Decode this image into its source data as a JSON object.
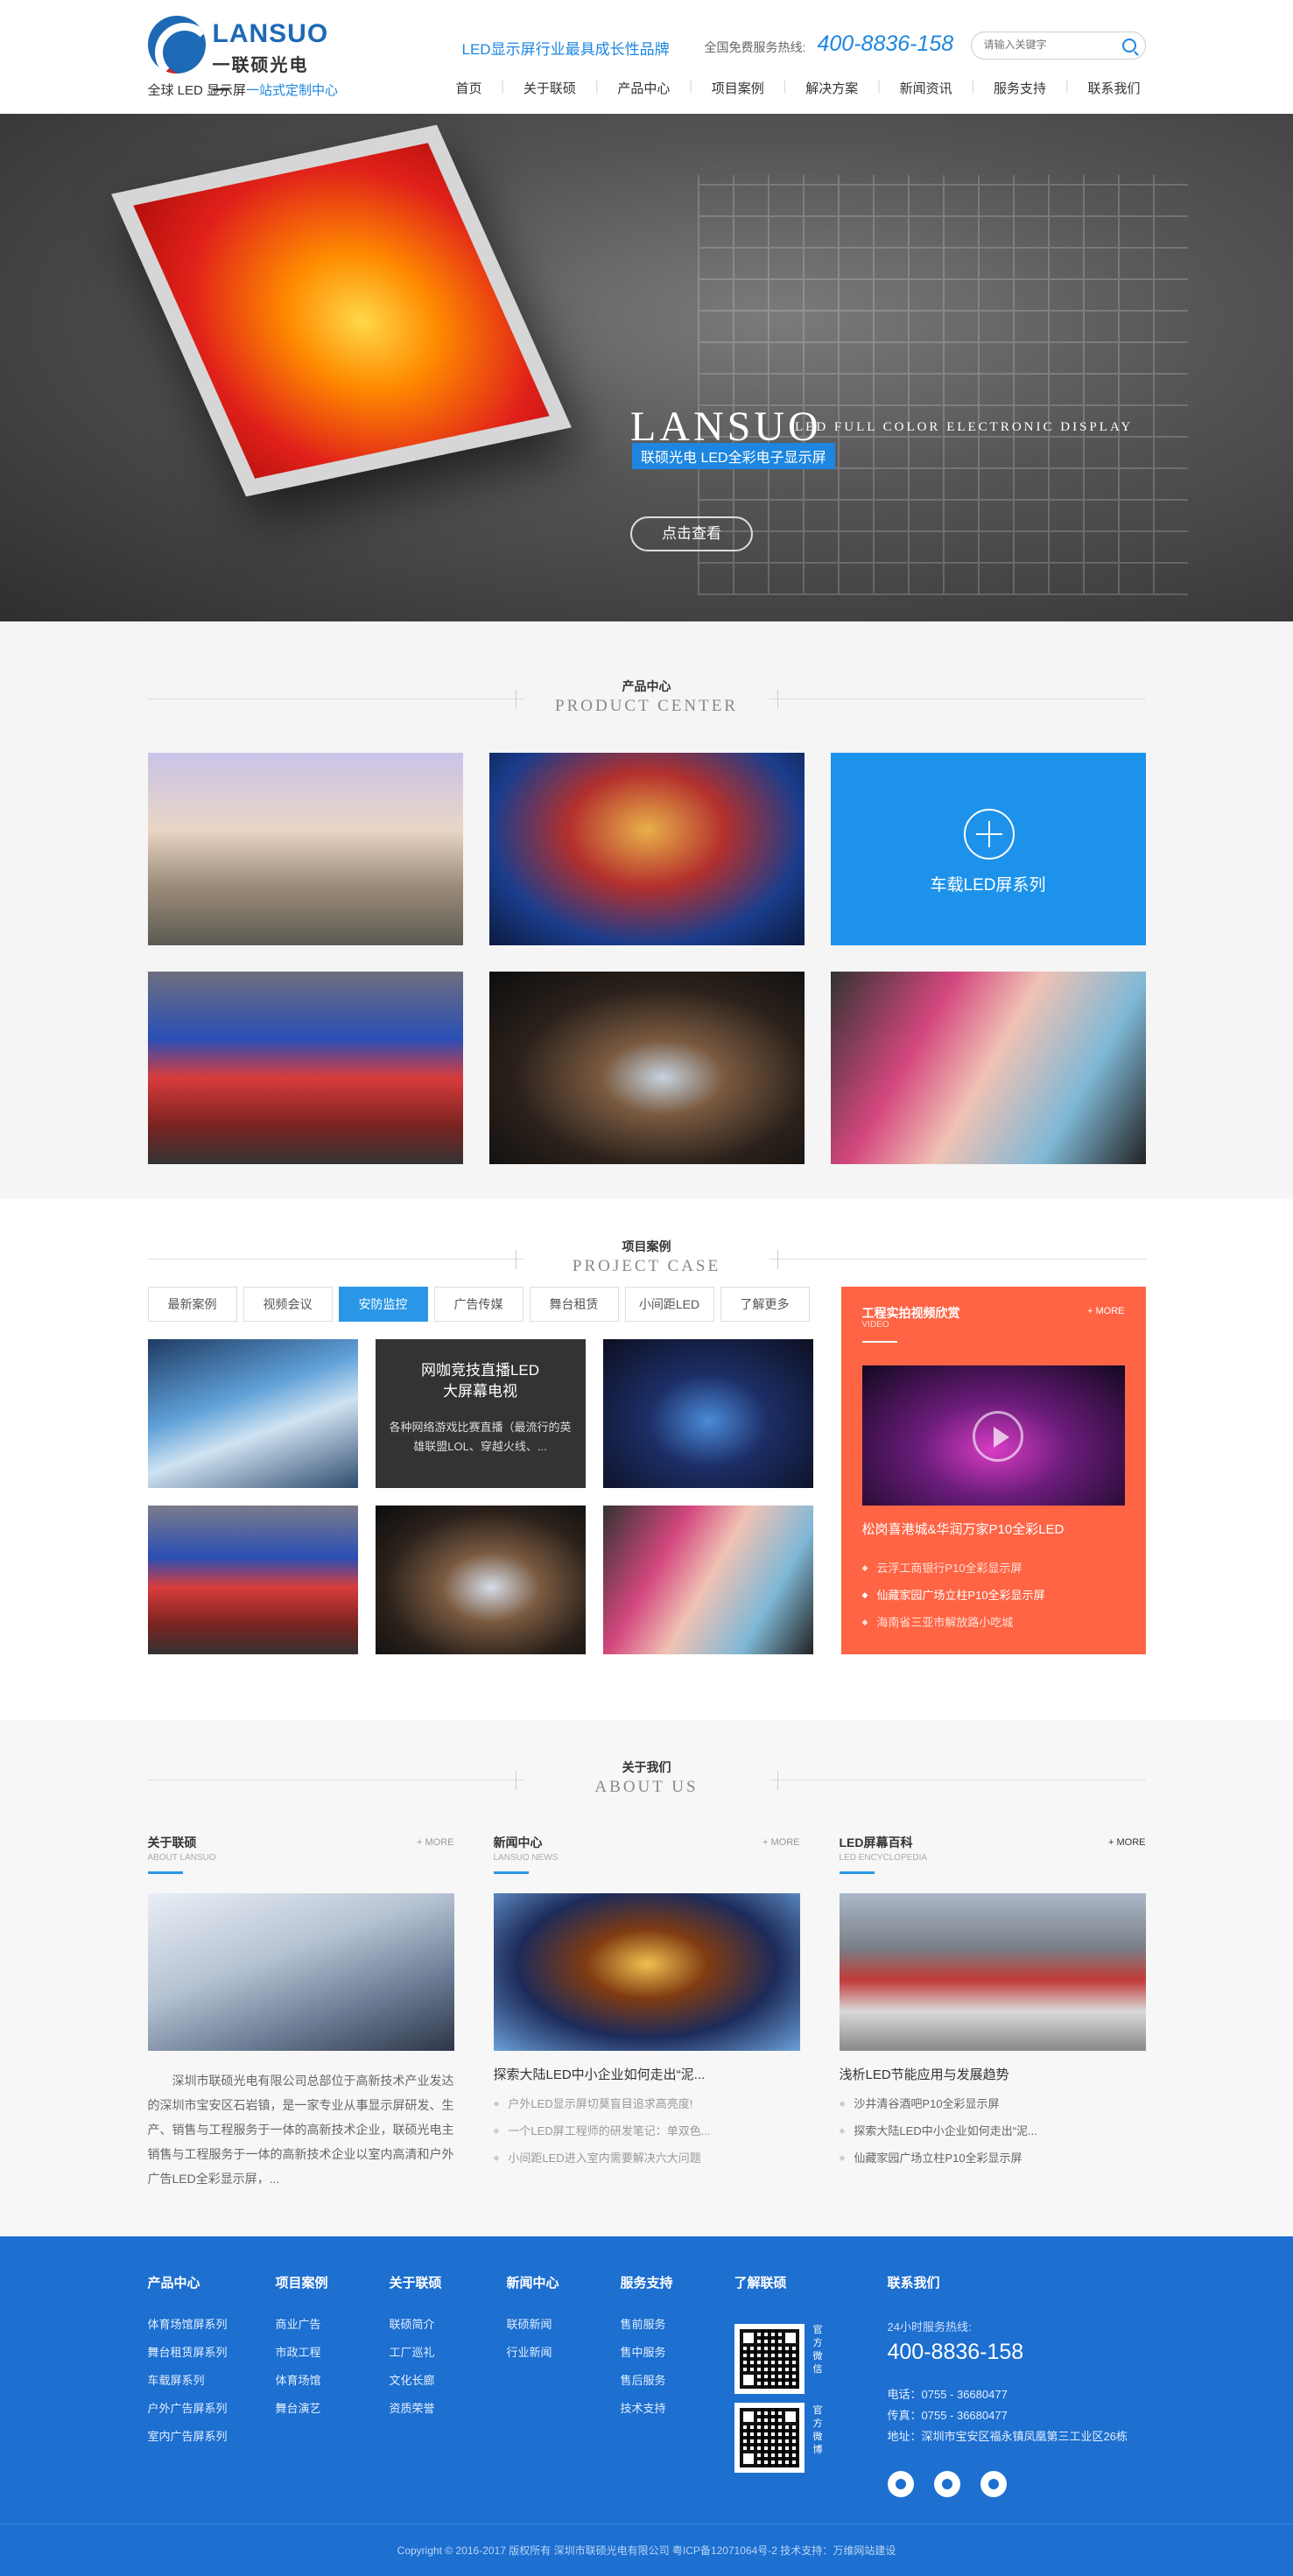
{
  "header": {
    "logo_word": "LANSUO",
    "logo_cn": "一联硕光电一",
    "logo_sub_a": "全球 LED 显示屏",
    "logo_sub_b": "一站式定制中心",
    "slogan": "LED显示屏行业最具成长性品牌",
    "hotline_label": "全国免费服务热线:",
    "hotline": "400-8836-158",
    "search_placeholder": "请输入关键字"
  },
  "nav": [
    "首页",
    "关于联硕",
    "产品中心",
    "项目案例",
    "解决方案",
    "新闻资讯",
    "服务支持",
    "联系我们"
  ],
  "banner": {
    "brand": "LANSUO",
    "en": "LED FULL COLOR ELECTRONIC DISPLAY",
    "cn": "联硕光电 LED全彩电子显示屏",
    "button": "点击查看"
  },
  "products": {
    "title_cn": "产品中心",
    "title_en": "PRODUCT CENTER",
    "feature_label": "车载LED屏系列"
  },
  "cases": {
    "title_cn": "项目案例",
    "title_en": "PROJECT CASE",
    "tabs": [
      "最新案例",
      "视频会议",
      "安防监控",
      "广告传媒",
      "舞台租赁",
      "小间距LED",
      "了解更多"
    ],
    "overlay_title": "网咖竞技直播LED\n大屏幕电视",
    "overlay_desc": "各种网络游戏比赛直播（最流行的英雄联盟LOL、穿越火线、..."
  },
  "video": {
    "title": "工程实拍视频欣赏",
    "en": "VIDEO",
    "more": "+ MORE",
    "caption": "松岗喜港城&华润万家P10全彩LED",
    "items": [
      "云浮工商银行P10全彩显示屏",
      "仙藏家园广场立柱P10全彩显示屏",
      "海南省三亚市解放路小吃城"
    ]
  },
  "about": {
    "title_cn": "关于我们",
    "title_en": "ABOUT US",
    "col1": {
      "h": "关于联硕",
      "en": "ABOUT LANSUO",
      "more": "+ MORE",
      "text": "深圳市联硕光电有限公司总部位于高新技术产业发达的深圳市宝安区石岩镇，是一家专业从事显示屏研发、生产、销售与工程服务于一体的高新技术企业，联硕光电主销售与工程服务于一体的高新技术企业以室内高清和户外广告LED全彩显示屏，..."
    },
    "col2": {
      "h": "新闻中心",
      "en": "LANSUO NEWS",
      "more": "+ MORE",
      "title": "探索大陆LED中小企业如何走出“泥...",
      "items": [
        "户外LED显示屏切莫盲目追求高亮度!",
        "一个LED屏工程师的研发笔记：单双色...",
        "小间距LED进入室内需要解决六大问题"
      ]
    },
    "col3": {
      "h": "LED屏幕百科",
      "en": "LED ENCYCLOPEDIA",
      "more": "+ MORE",
      "title": "浅析LED节能应用与发展趋势",
      "items": [
        "沙井清谷酒吧P10全彩显示屏",
        "探索大陆LED中小企业如何走出“泥...",
        "仙藏家园广场立柱P10全彩显示屏"
      ]
    }
  },
  "footer": {
    "cols": [
      {
        "h": "产品中心",
        "items": [
          "体育场馆屏系列",
          "舞台租赁屏系列",
          "车载屏系列",
          "户外广告屏系列",
          "室内广告屏系列"
        ]
      },
      {
        "h": "项目案例",
        "items": [
          "商业广告",
          "市政工程",
          "体育场馆",
          "舞台演艺"
        ]
      },
      {
        "h": "关于联硕",
        "items": [
          "联硕简介",
          "工厂巡礼",
          "文化长廊",
          "资质荣誉"
        ]
      },
      {
        "h": "新闻中心",
        "items": [
          "联硕新闻",
          "行业新闻"
        ]
      },
      {
        "h": "服务支持",
        "items": [
          "售前服务",
          "售中服务",
          "售后服务",
          "技术支持"
        ]
      },
      {
        "h": "了解联硕",
        "items": []
      }
    ],
    "qr1": "官方微信",
    "qr2": "官方微博",
    "contact_h": "联系我们",
    "hours": "24小时服务热线:",
    "tel": "400-8836-158",
    "phone": "电话：0755 - 36680477",
    "fax": "传真：0755 - 36680477",
    "addr": "地址：深圳市宝安区福永镇凤凰第三工业区26栋",
    "copyright": "Copyright © 2016-2017  版权所有  深圳市联硕光电有限公司  粤ICP备12071064号-2    技术支持：万维网站建设"
  }
}
